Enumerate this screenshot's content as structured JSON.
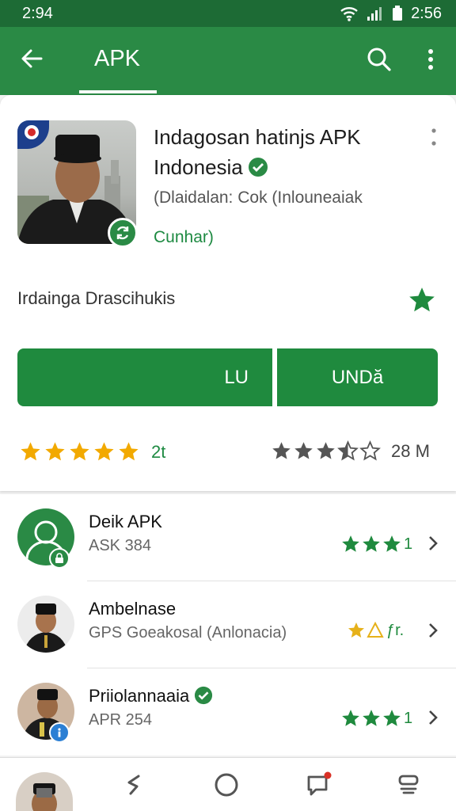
{
  "status_bar": {
    "time": "2:94",
    "right_text": "2:56"
  },
  "app_bar": {
    "title": "APK"
  },
  "app": {
    "name": "Indagosan hatinjs APK Indonesia",
    "subtitle": "(Dlaidalan: Cok (Inlouneaiak",
    "developer": "Cunhar)",
    "category": "Irdainga Drascihukis"
  },
  "buttons": {
    "left_label": "LU",
    "right_label": "UNDă"
  },
  "ratings": {
    "left_text": "2t",
    "right_text": "28 M"
  },
  "list": [
    {
      "title": "Deik APK",
      "subtitle": "ASK 384",
      "stars_text": "1",
      "verified": false,
      "stars_color": "#1f8a3e"
    },
    {
      "title": "Ambelnase",
      "subtitle": "GPS Goeakosal (Anlonacia)",
      "stars_text": "ƒr.",
      "verified": false,
      "stars_color": "#e6b11a"
    },
    {
      "title": "Priiolannaaia",
      "subtitle": "APR 254",
      "stars_text": "1",
      "verified": true,
      "stars_color": "#1f8a3e"
    }
  ],
  "colors": {
    "primary_dark": "#1d6b35",
    "primary": "#2a8a45",
    "accent": "#1f8a3e",
    "star_gold": "#f2a900"
  },
  "icons": [
    "back-arrow-icon",
    "search-icon",
    "overflow-menu-icon",
    "verified-icon",
    "star-icon",
    "chevron-right-icon",
    "back-gesture-icon",
    "home-circle-icon",
    "chat-notification-icon",
    "recents-icon"
  ]
}
